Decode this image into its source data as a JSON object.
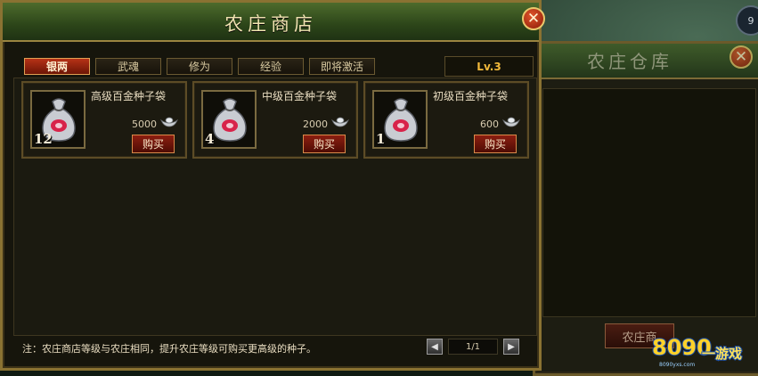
{
  "hud": {
    "badge": "9"
  },
  "warehouse": {
    "title": "农庄仓库",
    "shop_button": "农庄商"
  },
  "shop": {
    "title": "农庄商店",
    "tabs": [
      {
        "label": "银两",
        "active": true
      },
      {
        "label": "武魂",
        "active": false
      },
      {
        "label": "修为",
        "active": false
      },
      {
        "label": "经验",
        "active": false
      },
      {
        "label": "即将激活",
        "active": false
      }
    ],
    "level": "Lv.3",
    "items": [
      {
        "name": "高级百金种子袋",
        "price": "5000",
        "qty": "12",
        "buy": "购买"
      },
      {
        "name": "中级百金种子袋",
        "price": "2000",
        "qty": "4",
        "buy": "购买"
      },
      {
        "name": "初级百金种子袋",
        "price": "600",
        "qty": "1",
        "buy": "购买"
      }
    ],
    "note": "注：农庄商店等级与农庄相同，提升农庄等级可购买更高级的种子。",
    "pager": {
      "label": "1/1"
    }
  },
  "icons": {
    "close": "close-icon",
    "currency": "silver-ingot-icon",
    "item": "seed-bag-icon",
    "prev": "arrow-left-icon",
    "next": "arrow-right-icon"
  },
  "colors": {
    "accent": "#b63217",
    "level": "#f2b93a",
    "frame": "#8a7232"
  },
  "watermark": {
    "brand": "8090",
    "text": "一游戏",
    "url": "8090yxs.com"
  }
}
